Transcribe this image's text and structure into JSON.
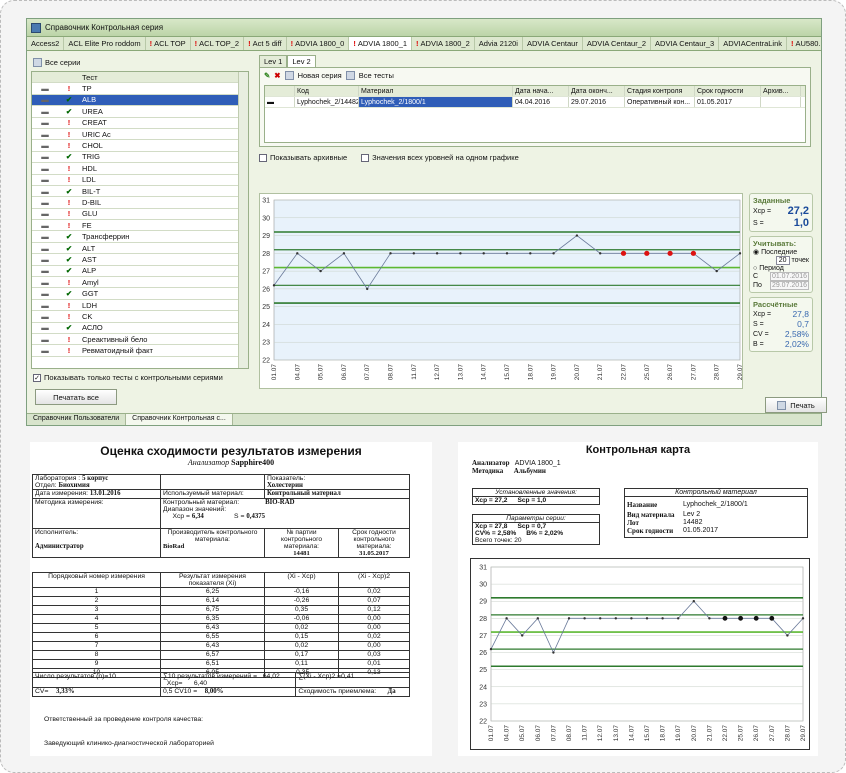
{
  "window": {
    "title": "Справочник Контрольная серия",
    "tabs": [
      {
        "label": "Access2",
        "bang": false
      },
      {
        "label": "ACL Elite Pro roddom",
        "bang": false
      },
      {
        "label": "ACL TOP",
        "bang": true
      },
      {
        "label": "ACL TOP_2",
        "bang": true
      },
      {
        "label": "Act 5 diff",
        "bang": true
      },
      {
        "label": "ADVIA 1800_0",
        "bang": true
      },
      {
        "label": "ADVIA 1800_1",
        "bang": true,
        "active": true
      },
      {
        "label": "ADVIA 1800_2",
        "bang": true
      },
      {
        "label": "Advia 2120i",
        "bang": false
      },
      {
        "label": "ADVIA Centaur",
        "bang": false
      },
      {
        "label": "ADVIA Centaur_2",
        "bang": false
      },
      {
        "label": "ADVIA Centaur_3",
        "bang": false
      },
      {
        "label": "ADVIACentraLink",
        "bang": false
      },
      {
        "label": "AU580...",
        "bang": true
      }
    ]
  },
  "left": {
    "all_series": "Все серии",
    "col_test": "Тест",
    "tests": [
      {
        "name": "TP",
        "mark": "!",
        "sel": false
      },
      {
        "name": "ALB",
        "mark": "✔",
        "sel": true
      },
      {
        "name": "UREA",
        "mark": "✔",
        "sel": false
      },
      {
        "name": "CREAT",
        "mark": "!",
        "sel": false
      },
      {
        "name": "URIC Ac",
        "mark": "!",
        "sel": false
      },
      {
        "name": "CHOL",
        "mark": "!",
        "sel": false
      },
      {
        "name": "TRIG",
        "mark": "✔",
        "sel": false
      },
      {
        "name": "HDL",
        "mark": "!",
        "sel": false
      },
      {
        "name": "LDL",
        "mark": "!",
        "sel": false
      },
      {
        "name": "BIL-T",
        "mark": "✔",
        "sel": false
      },
      {
        "name": "D-BIL",
        "mark": "!",
        "sel": false
      },
      {
        "name": "GLU",
        "mark": "!",
        "sel": false
      },
      {
        "name": "FE",
        "mark": "!",
        "sel": false
      },
      {
        "name": "Трансферрин",
        "mark": "✔",
        "sel": false
      },
      {
        "name": "ALT",
        "mark": "✔",
        "sel": false
      },
      {
        "name": "AST",
        "mark": "✔",
        "sel": false
      },
      {
        "name": "ALP",
        "mark": "✔",
        "sel": false
      },
      {
        "name": "Amyl",
        "mark": "!",
        "sel": false
      },
      {
        "name": "GGT",
        "mark": "✔",
        "sel": false
      },
      {
        "name": "LDH",
        "mark": "!",
        "sel": false
      },
      {
        "name": "CK",
        "mark": "!",
        "sel": false
      },
      {
        "name": "АСЛО",
        "mark": "✔",
        "sel": false
      },
      {
        "name": "Среактивный бело",
        "mark": "!",
        "sel": false
      },
      {
        "name": "Ревматоидный факт",
        "mark": "!",
        "sel": false
      }
    ],
    "only_control": "Показывать только тесты с контрольными сериями",
    "print_all": "Печатать все"
  },
  "right": {
    "lev_tabs": [
      "Lev 1",
      "Lev 2"
    ],
    "new_series": "Новая серия",
    "all_tests": "Все тесты",
    "cols": [
      "Код",
      "Материал",
      "Дата нача...",
      "Дата оконч...",
      "Стадия контроля",
      "Срок годности",
      "Архив..."
    ],
    "row": [
      "Lyphochek_2/14482",
      "Lyphochek_2/1800/1",
      "04.04.2016",
      "29.07.2016",
      "Оперативный кон...",
      "01.05.2017",
      ""
    ],
    "show_archive": "Показывать архивные",
    "all_levels": "Значения всех уровней на одном графике",
    "print": "Печать"
  },
  "side": {
    "given_title": "Заданные",
    "xcp_label": "Xcp =",
    "xcp_val": "27,2",
    "s_label": "S =",
    "s_val": "1,0",
    "account_title": "Учитывать:",
    "last_label": "Последние",
    "last_count": "20",
    "points_label": "точек",
    "period_label": "Период",
    "from_label": "С",
    "from_date": "01.07.2016",
    "to_label": "По",
    "to_date": "29.07.2016",
    "calc_title": "Рассчётные",
    "c_xcp": "27,8",
    "c_s": "0,7",
    "cv_label": "CV =",
    "cv": "2,58%",
    "b_label": "B =",
    "b": "2,02%"
  },
  "statusbar": [
    "Справочник Пользователи",
    "Справочник Контрольная с..."
  ],
  "chart_data": {
    "type": "line",
    "x": [
      "01.07",
      "04.07",
      "05.07",
      "06.07",
      "07.07",
      "08.07",
      "11.07",
      "12.07",
      "13.07",
      "14.07",
      "15.07",
      "18.07",
      "19.07",
      "20.07",
      "21.07",
      "22.07",
      "25.07",
      "26.07",
      "27.07",
      "28.07",
      "29.07"
    ],
    "values": [
      26.2,
      28,
      27,
      28,
      26,
      28,
      28,
      28,
      28,
      28,
      28,
      28,
      28,
      29,
      28,
      28,
      28,
      28,
      28,
      27,
      28
    ],
    "red_points": [
      15,
      16,
      17,
      18
    ],
    "ylim": [
      22,
      31
    ],
    "yticks": [
      22,
      23,
      24,
      25,
      26,
      27,
      28,
      29,
      30,
      31
    ],
    "lines": {
      "mean": 27.2,
      "sd1": [
        26.2,
        28.2
      ],
      "sd2": [
        25.2,
        29.2
      ]
    },
    "colors": {
      "mean": "#5db832",
      "sd": "#2e7a2e",
      "sd3": "#2e7a2e",
      "line": "#6a7a9a",
      "red": "#dd1111"
    }
  },
  "report1": {
    "title": "Оценка сходимости результатов измерения",
    "analyzer_label": "Анализатор",
    "analyzer": "Sapphire400",
    "lab_label": "Лаборатория :",
    "lab": "5 корпус",
    "dept_label": "Отдел:",
    "dept": "Биохимия",
    "indicator_label": "Показатель:",
    "indicator": "Холестерин",
    "date_label": "Дата измерения:",
    "date": "13.01.2016",
    "material_used_label": "Используемый материал:",
    "material_used": "Контрольный материал",
    "method_label": "Методика измерения:",
    "control_label": "Контрольный материал:",
    "control": "BIO-RAD",
    "range_label": "Диапазон значений:",
    "xcp_label": "Xcp =",
    "xcp": "6,34",
    "s_label": "S =",
    "s": "0,4375",
    "executor_label": "Исполнитель:",
    "maker_label": "Производитель контрольного материала:",
    "batch_label": "№ партии контрольного материала:",
    "expiry_label": "Срок годности контрольного материала:",
    "executor": "Администратор",
    "maker": "BioRad",
    "batch": "14481",
    "expiry": "31.05.2017",
    "col_n": "Порядковый номер измерения",
    "col_res": "Результат измерения показателя (Xi)",
    "col_d": "(Xi - Xcp)",
    "col_d2": "(Xi - Xcp)2",
    "rows": [
      [
        "1",
        "6,25",
        "-0,16",
        "0,02"
      ],
      [
        "2",
        "6,14",
        "-0,26",
        "0,07"
      ],
      [
        "3",
        "6,75",
        "0,35",
        "0,12"
      ],
      [
        "4",
        "6,35",
        "-0,06",
        "0,00"
      ],
      [
        "5",
        "6,43",
        "0,02",
        "0,00"
      ],
      [
        "6",
        "6,55",
        "0,15",
        "0,02"
      ],
      [
        "7",
        "6,43",
        "0,02",
        "0,00"
      ],
      [
        "8",
        "6,57",
        "0,17",
        "0,03"
      ],
      [
        "9",
        "6,51",
        "0,11",
        "0,01"
      ],
      [
        "10",
        "6,05",
        "-0,35",
        "0,13"
      ]
    ],
    "count_label": "Число результатов (n)=10",
    "sum_label": "∑10 результатов измерений =",
    "sum": "64,02",
    "sumsq_label": "∑(Xi - Xcp)2 =0,41",
    "xcp2_label": "Xcp=",
    "xcp2": "6,40",
    "cv_label": "CV=",
    "cv": "3,33%",
    "cv10_label": "0,5 CV10 =",
    "cv10": "8,00%",
    "conv_label": "Сходимость приемлема:",
    "conv": "Да",
    "resp1": "Ответственный за проведение контроля качества:",
    "resp2": "Заведующий клинико-диагностической лабораторией"
  },
  "report2": {
    "title": "Контрольная карта",
    "analyzer_label": "Анализатор",
    "analyzer": "ADVIA 1800_1",
    "method_label": "Методика",
    "method": "Альбумин",
    "given_title": "Установленные значения:",
    "g_xcp": "Xcp = 27,2",
    "g_s": "Scp = 1,0",
    "params_title": "Параметры серии:",
    "p_xcp": "Xcp = 27,8",
    "p_scp": "Scp = 0,7",
    "p_cv": "CV% = 2,58%",
    "p_b": "B% = 2,02%",
    "p_total": "Всего точек: 20",
    "ctrl_title": "Контрольный материал",
    "name_label": "Название",
    "name": "Lyphochek_2/1800/1",
    "type_label": "Вид материала",
    "type": "Lev 2",
    "lot_label": "Лот",
    "lot": "14482",
    "exp_label": "Срок годности",
    "exp": "01.05.2017"
  }
}
